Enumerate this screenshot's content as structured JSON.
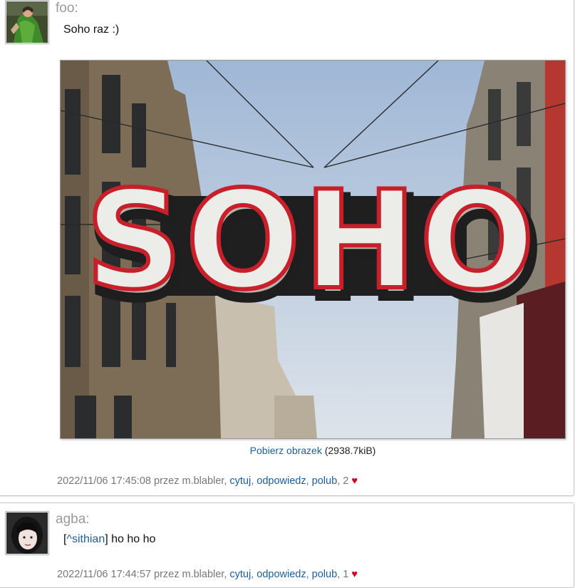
{
  "posts": [
    {
      "author": "foo:",
      "message": "Soho raz :)",
      "image": {
        "sign_text": "SOHO",
        "download_label": "Pobierz obrazek",
        "size": "(2938.7kiB)"
      },
      "meta": {
        "timestamp": "2022/11/06 17:45:08",
        "by_text": "przez m.blabler,",
        "actions": [
          "cytuj",
          "odpowiedz",
          "polub"
        ],
        "likes": "2",
        "heart": "♥"
      }
    },
    {
      "author": "agba:",
      "message": {
        "mention_open": "[",
        "mention": "^sithian",
        "mention_close": "]",
        "text": "ho ho ho"
      },
      "meta": {
        "timestamp": "2022/11/06 17:44:57",
        "by_text": "przez m.blabler,",
        "actions": [
          "cytuj",
          "odpowiedz",
          "polub"
        ],
        "likes": "1",
        "heart": "♥"
      }
    }
  ],
  "colors": {
    "link": "#1a5e9c",
    "heart": "#d0021b",
    "author": "#9a9a9a",
    "meta": "#777777",
    "sign_red": "#c8202a"
  }
}
